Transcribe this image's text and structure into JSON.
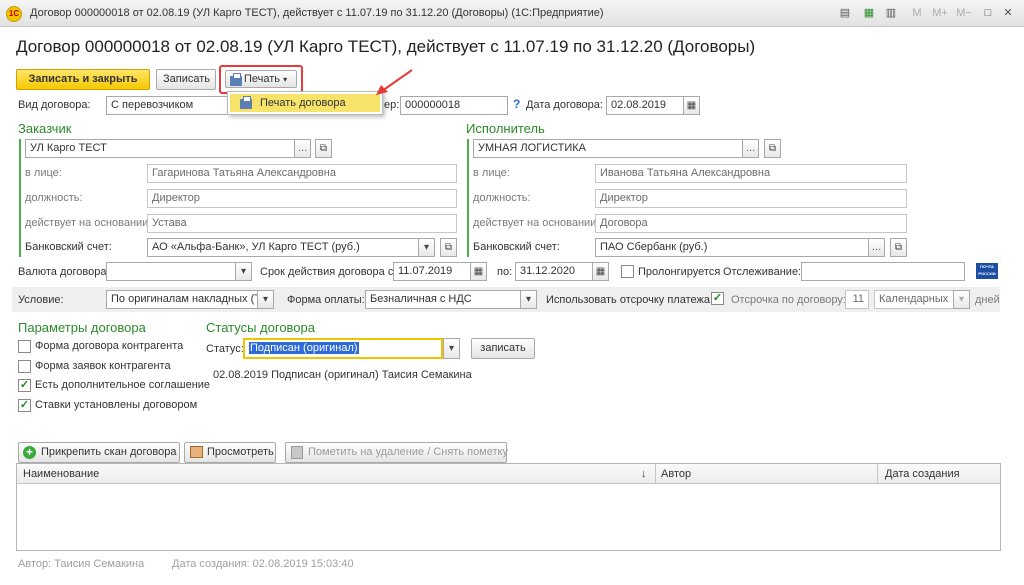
{
  "window": {
    "title": "Договор 000000018 от 02.08.19 (УЛ Карго ТЕСТ), действует с 11.07.19 по 31.12.20 (Договоры)  (1С:Предприятие)",
    "logo": "1С",
    "controls": {
      "m": "M",
      "mplus": "M+",
      "mminus": "M−",
      "restore": "□",
      "close": "✕"
    }
  },
  "page_title": "Договор 000000018 от 02.08.19 (УЛ Карго ТЕСТ), действует с 11.07.19 по 31.12.20 (Договоры)",
  "toolbar": {
    "save_close_label": "Записать и закрыть",
    "save_label": "Записать",
    "print_label": "Печать",
    "print_menu_item": "Печать договора"
  },
  "header": {
    "contract_type_label": "Вид договора:",
    "contract_type_value": "С перевозчиком",
    "number_label": "ер:",
    "number_value": "000000018",
    "help": "?",
    "date_label": "Дата договора:",
    "date_value": "02.08.2019"
  },
  "customer": {
    "title": "Заказчик",
    "name": "УЛ Карго ТЕСТ",
    "person_label": "в лице:",
    "person_value": "Гагаринова  Татьяна Александровна",
    "position_label": "должность:",
    "position_value": "Директор",
    "basis_label": "действует на основании:",
    "basis_value": "Устава",
    "bank_label": "Банковский счет:",
    "bank_value": "АО «Альфа-Банк», УЛ Карго ТЕСТ (руб.)"
  },
  "contractor": {
    "title": "Исполнитель",
    "name": "УМНАЯ ЛОГИСТИКА",
    "person_label": "в лице:",
    "person_value": "Иванова Татьяна Александровна",
    "position_label": "должность:",
    "position_value": "Директор",
    "basis_label": "действует на основании:",
    "basis_value": "Договора",
    "bank_label": "Банковский счет:",
    "bank_value": "ПАО Сбербанк    (руб.)"
  },
  "terms": {
    "currency_label": "Валюта договора:",
    "currency_value": "",
    "period_label": "Срок действия договора с:",
    "period_from": "11.07.2019",
    "period_to_label": "по:",
    "period_to": "31.12.2020",
    "prolong_label": "Пролонгируется",
    "tracking_label": "Отслеживание:",
    "tracking_value": "",
    "post_logo": "ПОЧТА РОССИИ"
  },
  "conditions": {
    "condition_label": "Условие:",
    "condition_value": "По оригиналам накладных (ТН",
    "payment_label": "Форма оплаты:",
    "payment_value": "Безналичная с НДС",
    "deferral_label": "Использовать отсрочку платежа:",
    "deferral_contract_label": "Отсрочка по договору:",
    "deferral_days": "11",
    "deferral_type": "Календарных",
    "days_label": "дней"
  },
  "params": {
    "title": "Параметры договора",
    "items": [
      {
        "label": "Форма договора контрагента",
        "checked": false
      },
      {
        "label": "Форма заявок контрагента",
        "checked": false
      },
      {
        "label": "Есть дополнительное соглашение",
        "checked": true
      },
      {
        "label": "Ставки установлены договором",
        "checked": true
      }
    ]
  },
  "statuses": {
    "title": "Статусы договора",
    "status_label": "Статус:",
    "status_value": "Подписан (оригинал)",
    "write_button": "записать",
    "history": "02.08.2019 Подписан (оригинал) Таисия Семакина"
  },
  "scans": {
    "attach_button": "Прикрепить скан договора",
    "view_button": "Просмотреть",
    "delete_button": "Пометить на удаление / Снять пометку",
    "columns": {
      "name": "Наименование",
      "sort": "↓",
      "author": "Автор",
      "created": "Дата создания"
    }
  },
  "footer": {
    "author": "Автор: Таисия Семакина",
    "created": "Дата создания: 02.08.2019 15:03:40"
  },
  "colors": {
    "accent": "#f5c800",
    "section": "#2c8a2c",
    "highlight": "#e53b3b",
    "menu_hover": "#f7e36a"
  }
}
